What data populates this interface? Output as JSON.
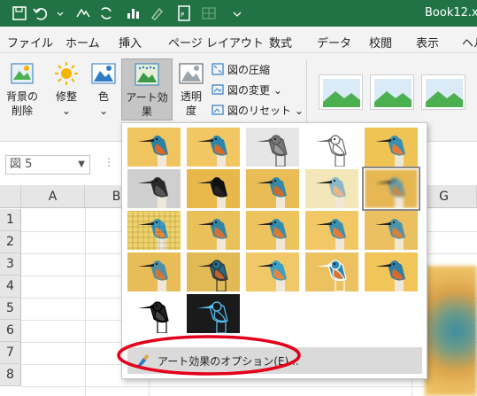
{
  "titlebar": {
    "doc_title": "Book12.x",
    "qa_icons": [
      "save-icon",
      "undo-icon",
      "autosave-icon",
      "refresh-icon",
      "chart-icon",
      "format-painter-icon",
      "pdf-icon",
      "table-icon"
    ]
  },
  "tabs": [
    "ファイル",
    "ホーム",
    "挿入",
    "ページ レイアウト",
    "数式",
    "データ",
    "校閲",
    "表示",
    "ヘル"
  ],
  "ribbon": {
    "remove_bg": {
      "line1": "背景の",
      "line2": "削除"
    },
    "corrections": "修整",
    "color": "色",
    "artistic": "アート効果",
    "transparency": {
      "line1": "透明",
      "line2": "度"
    },
    "compress": "図の圧縮",
    "change": "図の変更",
    "reset": "図のリセット",
    "dropdown_arrow": "⌄"
  },
  "namebox": {
    "value": "図 5"
  },
  "columns": [
    "A",
    "B",
    "G"
  ],
  "rows": [
    "1",
    "2",
    "3",
    "4",
    "5",
    "6",
    "7",
    "8"
  ],
  "gallery": {
    "selected_index": 9,
    "effects": [
      "なし",
      "マーカー",
      "鉛筆: スケッチ",
      "線画",
      "チョーク: スケッチ",
      "ペイント: 描線",
      "ペイント: ブラシ",
      "光彩: 輪郭",
      "ぼかし",
      "ライトスクリーン",
      "水彩: スポンジ",
      "フィルム粒子",
      "モザイク: バブル",
      "ガラス",
      "セメント",
      "テクスチャライザー",
      "十字模様: エッチング",
      "パステル: 滑らか",
      "ラップフィルム",
      "カットアウト",
      "白黒コピー",
      "光彩: エッジ"
    ],
    "options_label": "アート効果のオプション(E)..."
  },
  "colors": {
    "title_green": "#217346",
    "ribbon_bg": "#f3f3f3",
    "annotation_red": "#e3001b"
  }
}
